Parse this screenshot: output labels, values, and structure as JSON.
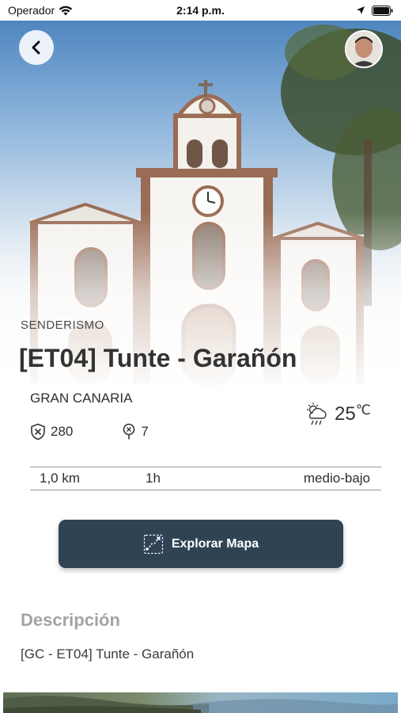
{
  "status_bar": {
    "carrier": "Operador",
    "time": "2:14 p.m."
  },
  "hero": {
    "category": "SENDERISMO",
    "title": "[ET04] Tunte - Garañón"
  },
  "route": {
    "island": "GRAN CANARIA",
    "stat_score": "280",
    "stat_points": "7",
    "temperature": "25",
    "temperature_unit": "℃",
    "distance": "1,0 km",
    "duration": "1h",
    "difficulty": "medio-bajo"
  },
  "actions": {
    "explore_map_label": "Explorar Mapa"
  },
  "description": {
    "heading": "Descripción",
    "text": "[GC - ET04] Tunte - Garañón"
  },
  "colors": {
    "button_bg": "#2f4355",
    "muted_heading": "#a3a3a3"
  },
  "icons": [
    "back-arrow-icon",
    "wifi-icon",
    "location-arrow-icon",
    "battery-icon",
    "shield-icon",
    "pin-icon",
    "cloudy-rain-icon",
    "map-route-icon"
  ]
}
